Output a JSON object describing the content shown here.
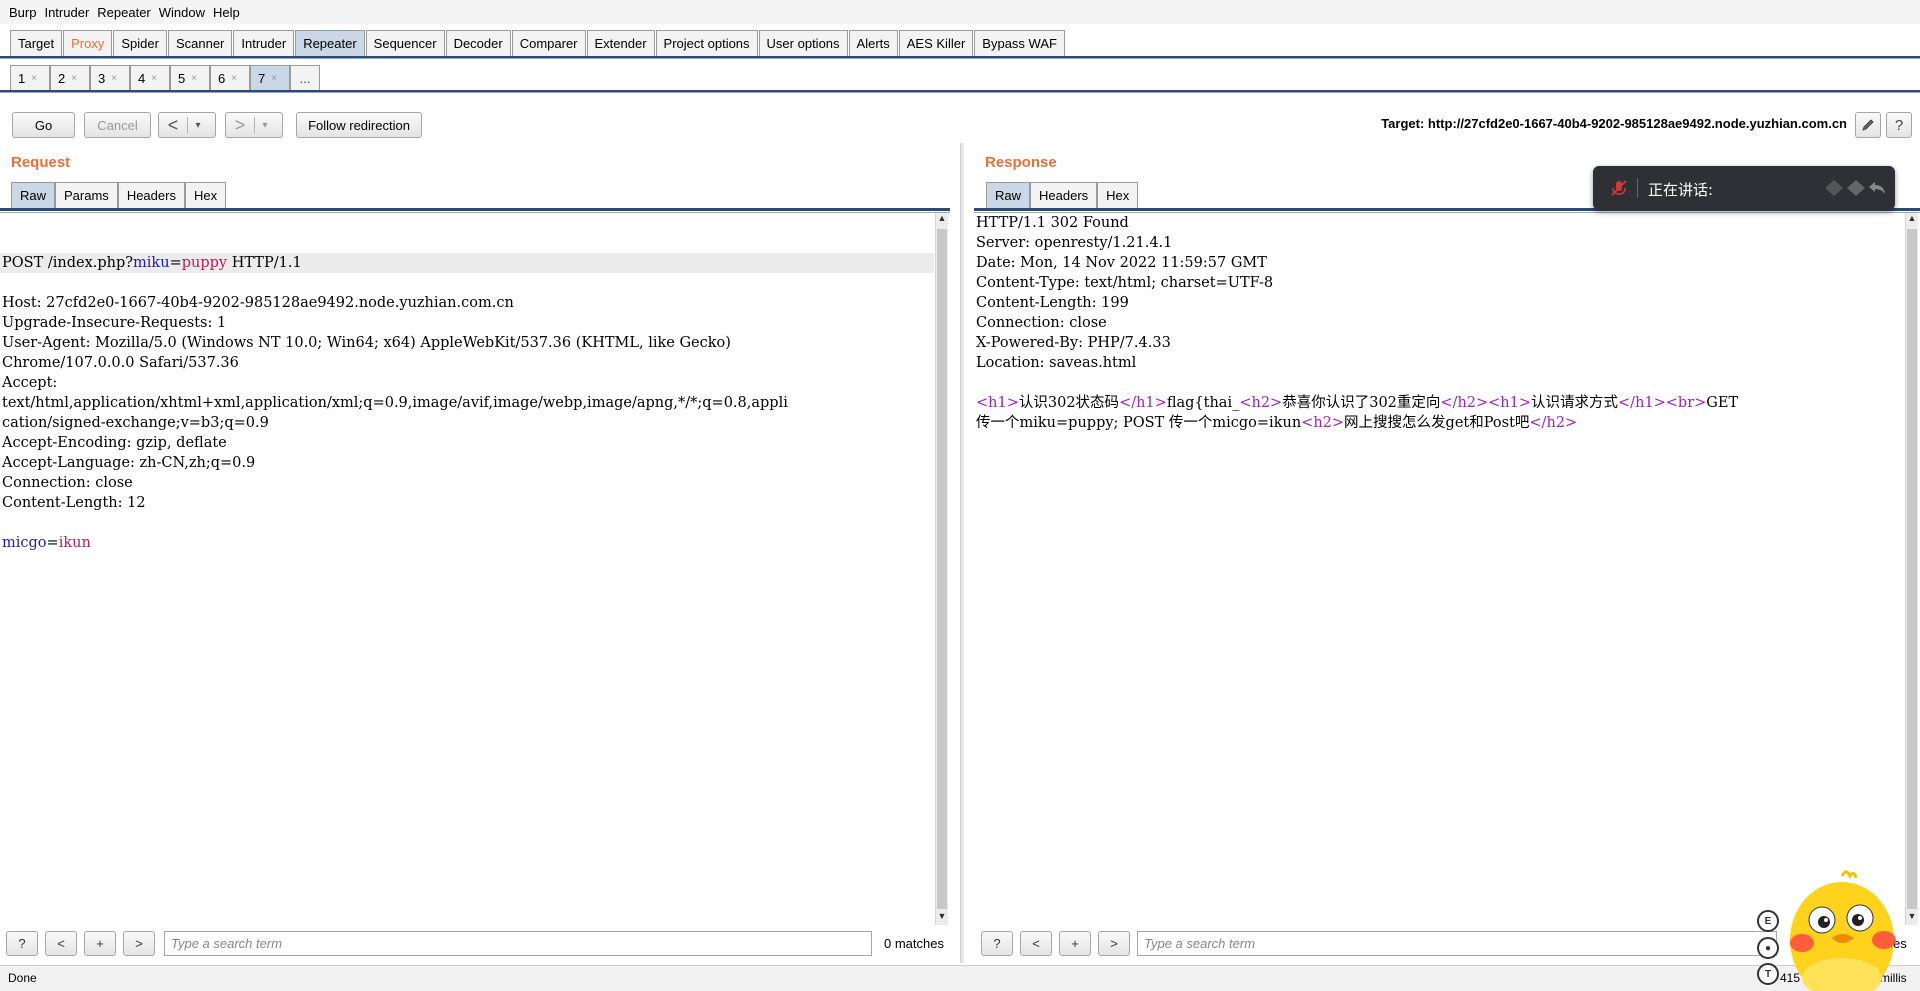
{
  "menu": [
    "Burp",
    "Intruder",
    "Repeater",
    "Window",
    "Help"
  ],
  "main_tabs": [
    {
      "label": "Target",
      "state": "normal"
    },
    {
      "label": "Proxy",
      "state": "accent"
    },
    {
      "label": "Spider",
      "state": "normal"
    },
    {
      "label": "Scanner",
      "state": "normal"
    },
    {
      "label": "Intruder",
      "state": "normal"
    },
    {
      "label": "Repeater",
      "state": "active"
    },
    {
      "label": "Sequencer",
      "state": "normal"
    },
    {
      "label": "Decoder",
      "state": "normal"
    },
    {
      "label": "Comparer",
      "state": "normal"
    },
    {
      "label": "Extender",
      "state": "normal"
    },
    {
      "label": "Project options",
      "state": "normal"
    },
    {
      "label": "User options",
      "state": "normal"
    },
    {
      "label": "Alerts",
      "state": "normal"
    },
    {
      "label": "AES Killer",
      "state": "normal"
    },
    {
      "label": "Bypass WAF",
      "state": "normal"
    }
  ],
  "sub_tabs": [
    "1",
    "2",
    "3",
    "4",
    "5",
    "6",
    "7"
  ],
  "sub_tabs_active": "7",
  "sub_tab_close": "×",
  "sub_tab_more": "...",
  "toolbar": {
    "go": "Go",
    "cancel": "Cancel",
    "back_arrow": "<",
    "forward_arrow": ">",
    "dropdown": "▾",
    "follow": "Follow redirection",
    "target": "Target: http://27cfd2e0-1667-40b4-9202-985128ae9492.node.yuzhian.com.cn",
    "help": "?"
  },
  "request": {
    "title": "Request",
    "tabs": [
      "Raw",
      "Params",
      "Headers",
      "Hex"
    ],
    "first_line": {
      "pre": "POST /index.php?",
      "key": "miku",
      "eq": "=",
      "val": "puppy",
      "post": " HTTP/1.1"
    },
    "lines": [
      "Host: 27cfd2e0-1667-40b4-9202-985128ae9492.node.yuzhian.com.cn",
      "Upgrade-Insecure-Requests: 1",
      "User-Agent: Mozilla/5.0 (Windows NT 10.0; Win64; x64) AppleWebKit/537.36 (KHTML, like Gecko)",
      "Chrome/107.0.0.0 Safari/537.36",
      "Accept:",
      "text/html,application/xhtml+xml,application/xml;q=0.9,image/avif,image/webp,image/apng,*/*;q=0.8,appli",
      "cation/signed-exchange;v=b3;q=0.9",
      "Accept-Encoding: gzip, deflate",
      "Accept-Language: zh-CN,zh;q=0.9",
      "Connection: close",
      "Content-Length: 12",
      ""
    ],
    "body": {
      "key": "micgo",
      "eq": "=",
      "val": "ikun"
    },
    "search_placeholder": "Type a search term",
    "matches": "0 matches"
  },
  "response": {
    "title": "Response",
    "tabs": [
      "Raw",
      "Headers",
      "Hex"
    ],
    "lines": [
      "HTTP/1.1 302 Found",
      "Server: openresty/1.21.4.1",
      "Date: Mon, 14 Nov 2022 11:59:57 GMT",
      "Content-Type: text/html; charset=UTF-8",
      "Content-Length: 199",
      "Connection: close",
      "X-Powered-By: PHP/7.4.33",
      "Location: saveas.html",
      ""
    ],
    "html_line1": [
      {
        "t": "tag",
        "s": "<h1>"
      },
      {
        "t": "text",
        "s": "认识302状态码"
      },
      {
        "t": "tag",
        "s": "</h1>"
      },
      {
        "t": "text",
        "s": "flag{thai_"
      },
      {
        "t": "tag",
        "s": "<h2>"
      },
      {
        "t": "text",
        "s": "恭喜你认识了302重定向"
      },
      {
        "t": "tag",
        "s": "</h2>"
      },
      {
        "t": "tag",
        "s": "<h1>"
      },
      {
        "t": "text",
        "s": "认识请求方式"
      },
      {
        "t": "tag",
        "s": "</h1>"
      },
      {
        "t": "tag",
        "s": "<br>"
      },
      {
        "t": "text",
        "s": "GET"
      }
    ],
    "html_line2": [
      {
        "t": "text",
        "s": "传一个miku=puppy; POST 传一个micgo=ikun"
      },
      {
        "t": "tag",
        "s": "<h2>"
      },
      {
        "t": "text",
        "s": "网上搜搜怎么发get和Post吧"
      },
      {
        "t": "tag",
        "s": "</h2>"
      }
    ],
    "search_placeholder": "Type a search term",
    "matches_partial": "es"
  },
  "search_buttons": [
    "?",
    "<",
    "+",
    ">"
  ],
  "status": {
    "left": "Done",
    "right_partial": "415",
    "right_partial2": "millis"
  },
  "overlay": {
    "label": "正在讲话:"
  }
}
